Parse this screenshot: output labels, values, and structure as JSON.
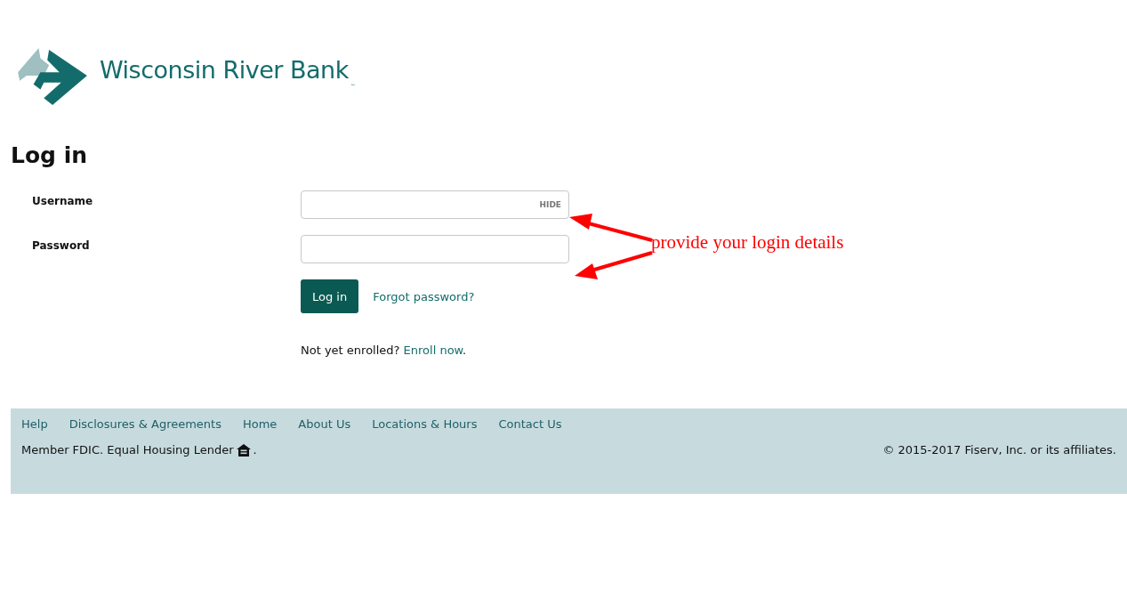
{
  "logo": {
    "name": "Wisconsin River Bank",
    "trademark": "™"
  },
  "heading": "Log in",
  "fields": [
    {
      "label": "Username",
      "toggle": "HIDE"
    },
    {
      "label": "Password"
    }
  ],
  "login_button": "Log in",
  "forgot_link": "Forgot password?",
  "enroll": {
    "text": "Not yet enrolled?",
    "link": "Enroll now",
    "end": "."
  },
  "annotation": "provide your login details",
  "footer": {
    "links": [
      "Help",
      "Disclosures & Agreements",
      "Home",
      "About Us",
      "Locations & Hours",
      "Contact Us"
    ],
    "notice": "Member FDIC. Equal Housing Lender",
    "notice_end": ".",
    "copyright": "© 2015-2017 Fiserv, Inc. or its affiliates."
  }
}
